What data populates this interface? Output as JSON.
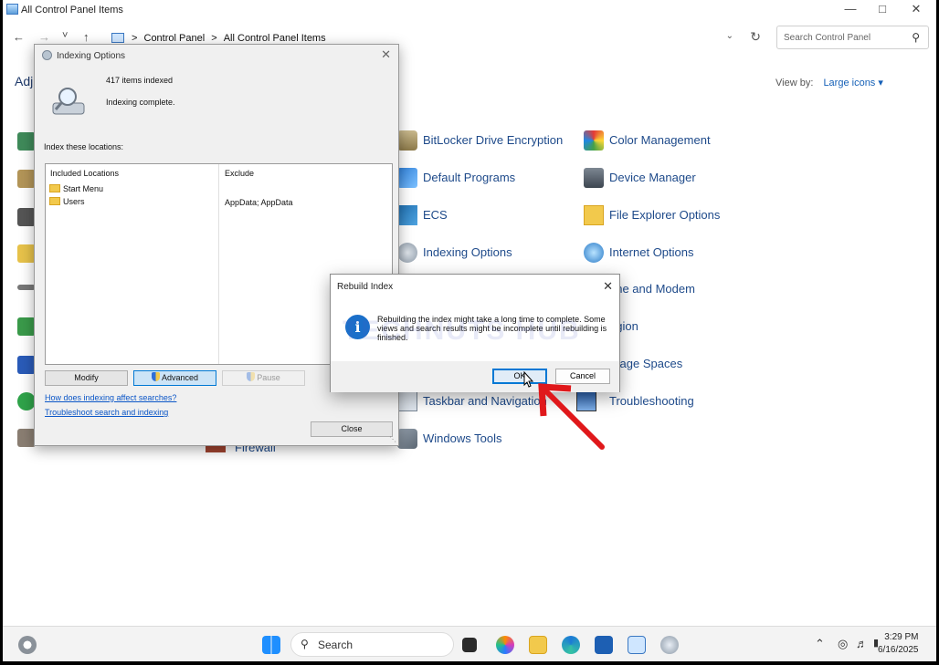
{
  "window": {
    "title": "All Control Panel Items",
    "breadcrumbs": [
      "Control Panel",
      "All Control Panel Items"
    ],
    "search_placeholder": "Search Control Panel",
    "heading_partial": "Adj",
    "view_by_label": "View by:",
    "view_by_value": "Large icons ▾"
  },
  "nav": {
    "back": "←",
    "forward": "→",
    "recent": "˅",
    "up": "↑",
    "sep": ">"
  },
  "cp_items": [
    {
      "label": "BitLocker Drive Encryption",
      "icon": "bitlocker-icon"
    },
    {
      "label": "Default Programs",
      "icon": "default-programs-icon"
    },
    {
      "label": "ECS",
      "icon": "ecs-icon"
    },
    {
      "label": "Indexing Options",
      "icon": "indexing-icon"
    },
    {
      "label": "Taskbar and Navigation",
      "icon": "taskbar-icon"
    },
    {
      "label": "Windows Tools",
      "icon": "windows-tools-icon"
    },
    {
      "label": "Color Management",
      "icon": "color-management-icon"
    },
    {
      "label": "Device Manager",
      "icon": "device-manager-icon"
    },
    {
      "label": "File Explorer Options",
      "icon": "file-explorer-options-icon"
    },
    {
      "label": "Internet Options",
      "icon": "internet-options-icon"
    },
    {
      "label": "one and Modem",
      "icon": "phone-modem-icon"
    },
    {
      "label": "egion",
      "icon": "region-icon"
    },
    {
      "label": "orage Spaces",
      "icon": "storage-spaces-icon"
    },
    {
      "label": "Troubleshooting",
      "icon": "troubleshooting-icon"
    },
    {
      "label": "Firewall",
      "icon": "firewall-icon"
    }
  ],
  "indexing": {
    "title": "Indexing Options",
    "count": "417 items indexed",
    "status": "Indexing complete.",
    "locations_label": "Index these locations:",
    "col_included": "Included Locations",
    "col_exclude": "Exclude",
    "rows": [
      {
        "name": "Start Menu",
        "exclude": ""
      },
      {
        "name": "Users",
        "exclude": "AppData; AppData"
      }
    ],
    "modify": "Modify",
    "advanced": "Advanced",
    "pause": "Pause",
    "link1": "How does indexing affect searches?",
    "link2": "Troubleshoot search and indexing",
    "close": "Close"
  },
  "rebuild": {
    "title": "Rebuild Index",
    "message": "Rebuilding the index might take a long time to complete. Some views and search results might be incomplete until rebuilding is finished.",
    "ok": "OK",
    "cancel": "Cancel"
  },
  "watermark": "TECHNUTS HUB",
  "taskbar": {
    "search": "Search",
    "time": "3:29 PM",
    "date": "6/16/2025"
  },
  "colors": {
    "accent": "#0078d4",
    "link": "#1e4a8a",
    "arrow": "#e0181b"
  }
}
